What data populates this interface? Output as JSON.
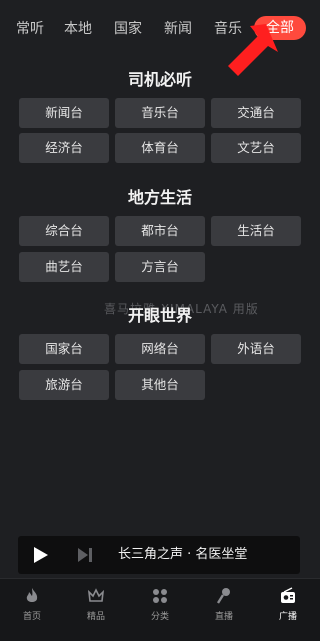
{
  "tabs": [
    "常听",
    "本地",
    "国家",
    "新闻",
    "音乐"
  ],
  "active_tab": "全部",
  "sections": [
    {
      "title": "司机必听",
      "items": [
        "新闻台",
        "音乐台",
        "交通台",
        "经济台",
        "体育台",
        "文艺台"
      ]
    },
    {
      "title": "地方生活",
      "items": [
        "综合台",
        "都市台",
        "生活台",
        "曲艺台",
        "方言台"
      ]
    },
    {
      "title": "开眼世界",
      "items": [
        "国家台",
        "网络台",
        "外语台",
        "旅游台",
        "其他台"
      ]
    }
  ],
  "watermark": "喜马拉雅 XIMALAYA 用版",
  "player": {
    "title": "长三角之声 · 名医坐堂"
  },
  "nav": [
    {
      "label": "首页",
      "icon": "flame-icon"
    },
    {
      "label": "精品",
      "icon": "crown-icon"
    },
    {
      "label": "分类",
      "icon": "grid-icon"
    },
    {
      "label": "直播",
      "icon": "microphone-icon"
    },
    {
      "label": "广播",
      "icon": "radio-icon"
    }
  ],
  "colors": {
    "accent": "#ff4a3d",
    "background": "#1e1f22",
    "button": "#3a3b3f"
  }
}
